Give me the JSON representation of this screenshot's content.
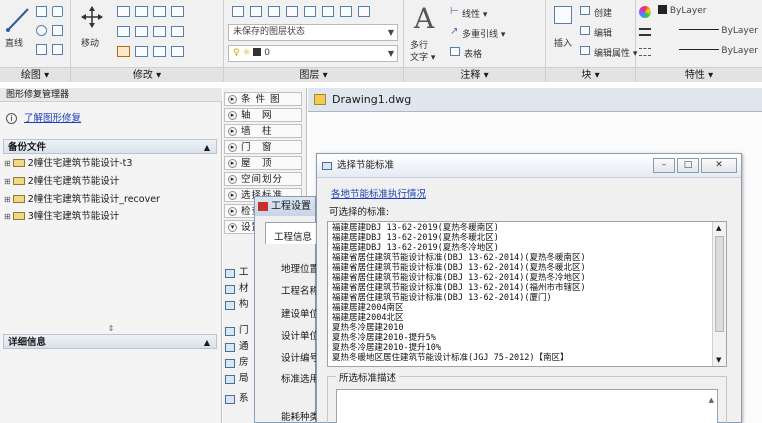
{
  "ribbon": {
    "draw_panel": {
      "label": "绘图 ▾",
      "line_label": "直线"
    },
    "modify_panel": {
      "label": "修改 ▾",
      "move_label": "移动"
    },
    "layer_panel": {
      "label": "图层 ▾",
      "layer_state": "未保存的图层状态",
      "current_layer": "0"
    },
    "annotation_panel": {
      "label": "注释 ▾",
      "multiline_text_label_top": "多行",
      "multiline_text_label_bottom": "文字 ▾",
      "linear_label": "线性 ▾",
      "multileader_label": "多重引线 ▾",
      "table_label": "表格"
    },
    "block_panel": {
      "label": "块 ▾",
      "insert_label": "插入",
      "create_label": "创建",
      "edit_label": "编辑",
      "edit_attr_label": "编辑属性 ▾"
    },
    "properties_panel": {
      "label": "特性 ▾",
      "color_value": "ByLayer",
      "linetype_value": "ByLayer",
      "lineweight_value": "ByLayer"
    }
  },
  "left_pane": {
    "title": "图形修复管理器",
    "help_link": "了解图形修复",
    "backup_header": "备份文件",
    "backup_files": [
      "2幢住宅建筑节能设计-t3",
      "2幢住宅建筑节能设计",
      "2幢住宅建筑节能设计_recover",
      "3幢住宅建筑节能设计"
    ],
    "details_header": "详细信息"
  },
  "mid_pane": {
    "tree_items": [
      "条 件 图",
      "轴　网",
      "墙　柱",
      "门　窗",
      "屋　顶",
      "空间划分",
      "选择标准",
      "检查",
      "设置"
    ],
    "rows": [
      "工",
      "材",
      "构",
      "门",
      "通",
      "房",
      "局",
      "系"
    ]
  },
  "document": {
    "tab_title": "Drawing1.dwg"
  },
  "project_dialog": {
    "title": "工程设置",
    "labels": [
      "工程信息",
      "地理位置",
      "工程名称",
      "建设单位",
      "设计单位",
      "设计编号",
      "标准选用",
      "能耗种类"
    ]
  },
  "standards_dialog": {
    "title": "选择节能标准",
    "link": "各地节能标准执行情况",
    "available_label": "可选择的标准:",
    "standards": [
      "福建居建DBJ 13-62-2019(夏热冬暖南区)",
      "福建居建DBJ 13-62-2019(夏热冬暖北区)",
      "福建居建DBJ 13-62-2019(夏热冬冷地区)",
      "福建省居住建筑节能设计标准(DBJ 13-62-2014)(夏热冬暖南区)",
      "福建省居住建筑节能设计标准(DBJ 13-62-2014)(夏热冬暖北区)",
      "福建省居住建筑节能设计标准(DBJ 13-62-2014)(夏热冬冷地区)",
      "福建省居住建筑节能设计标准(DBJ 13-62-2014)(福州市市辖区)",
      "福建省居住建筑节能设计标准(DBJ 13-62-2014)(厦门)",
      "福建居建2004南区",
      "福建居建2004北区",
      "夏热冬冷居建2010",
      "夏热冬冷居建2010-提升5%",
      "夏热冬冷居建2010-提升10%",
      "夏热冬暖地区居住建筑节能设计标准(JGJ 75-2012)【南区】"
    ],
    "description_group": "所选标准描述"
  },
  "colors": {
    "accent_blue": "#1a3fb4",
    "ribbon_bg": "#f1f1f1",
    "canvas_gray": "#ababab"
  }
}
